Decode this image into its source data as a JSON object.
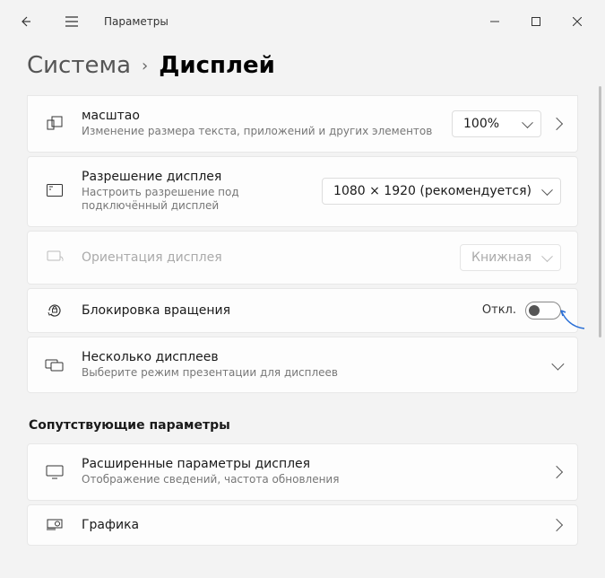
{
  "window": {
    "title": "Параметры"
  },
  "breadcrumb": {
    "parent": "Система",
    "current": "Дисплей"
  },
  "rows": {
    "scale": {
      "title": "масштао",
      "sub": "Изменение размера текста, приложений и других элементов",
      "value": "100%"
    },
    "resolution": {
      "title": "Разрешение дисплея",
      "sub": "Настроить разрешение под подключённый дисплей",
      "value": "1080 × 1920 (рекомендуется)"
    },
    "orientation": {
      "title": "Ориентация дисплея",
      "value": "Книжная"
    },
    "rotation_lock": {
      "title": "Блокировка вращения",
      "state": "Откл."
    },
    "multi": {
      "title": "Несколько дисплеев",
      "sub": "Выберите режим презентации для дисплеев"
    }
  },
  "related": {
    "heading": "Сопутствующие параметры",
    "advanced": {
      "title": "Расширенные параметры дисплея",
      "sub": "Отображение сведений, частота обновления"
    },
    "graphics": {
      "title": "Графика"
    }
  }
}
